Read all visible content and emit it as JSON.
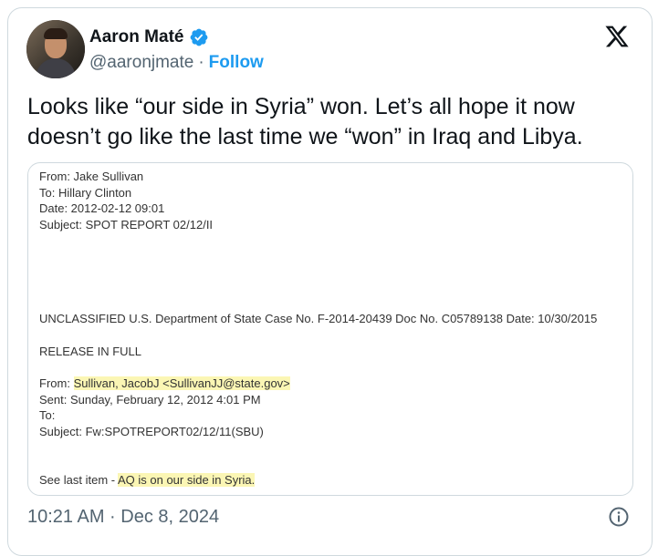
{
  "author": {
    "name": "Aaron Maté",
    "handle": "@aaronjmate",
    "separator": "·",
    "follow_label": "Follow"
  },
  "tweet": {
    "lines": [
      "Looks like “our side in Syria” won. Let’s all hope it now",
      "doesn’t go like the last time we “won” in Iraq and Libya."
    ]
  },
  "document": {
    "header": {
      "from": "From: Jake Sullivan",
      "to": "To: Hillary Clinton",
      "date": "Date: 2012-02-12 09:01",
      "subject": "Subject: SPOT REPORT 02/12/II"
    },
    "case_line": "UNCLASSIFIED U.S. Department of State Case No. F-2014-20439 Doc No. C05789138 Date: 10/30/2015",
    "release": "RELEASE IN FULL",
    "email": {
      "from_prefix": "From: ",
      "from_value": "Sullivan, JacobJ <SullivanJJ@state.gov>",
      "sent": "Sent: Sunday, February 12, 2012 4:01 PM",
      "to": "To:",
      "subject": "Subject: Fw:SPOTREPORT02/12/11(SBU)"
    },
    "body_prefix": "See last item - ",
    "body_highlight": "AQ is on our side in Syria."
  },
  "footer": {
    "timestamp": "10:21 AM · Dec 8, 2024"
  },
  "colors": {
    "accent": "#1d9bf0",
    "muted": "#536471",
    "highlight": "#fbf6b4",
    "border": "#cfd9de"
  },
  "icons": {
    "verified": "verified-badge-icon",
    "platform": "x-logo-icon",
    "info": "info-icon"
  }
}
